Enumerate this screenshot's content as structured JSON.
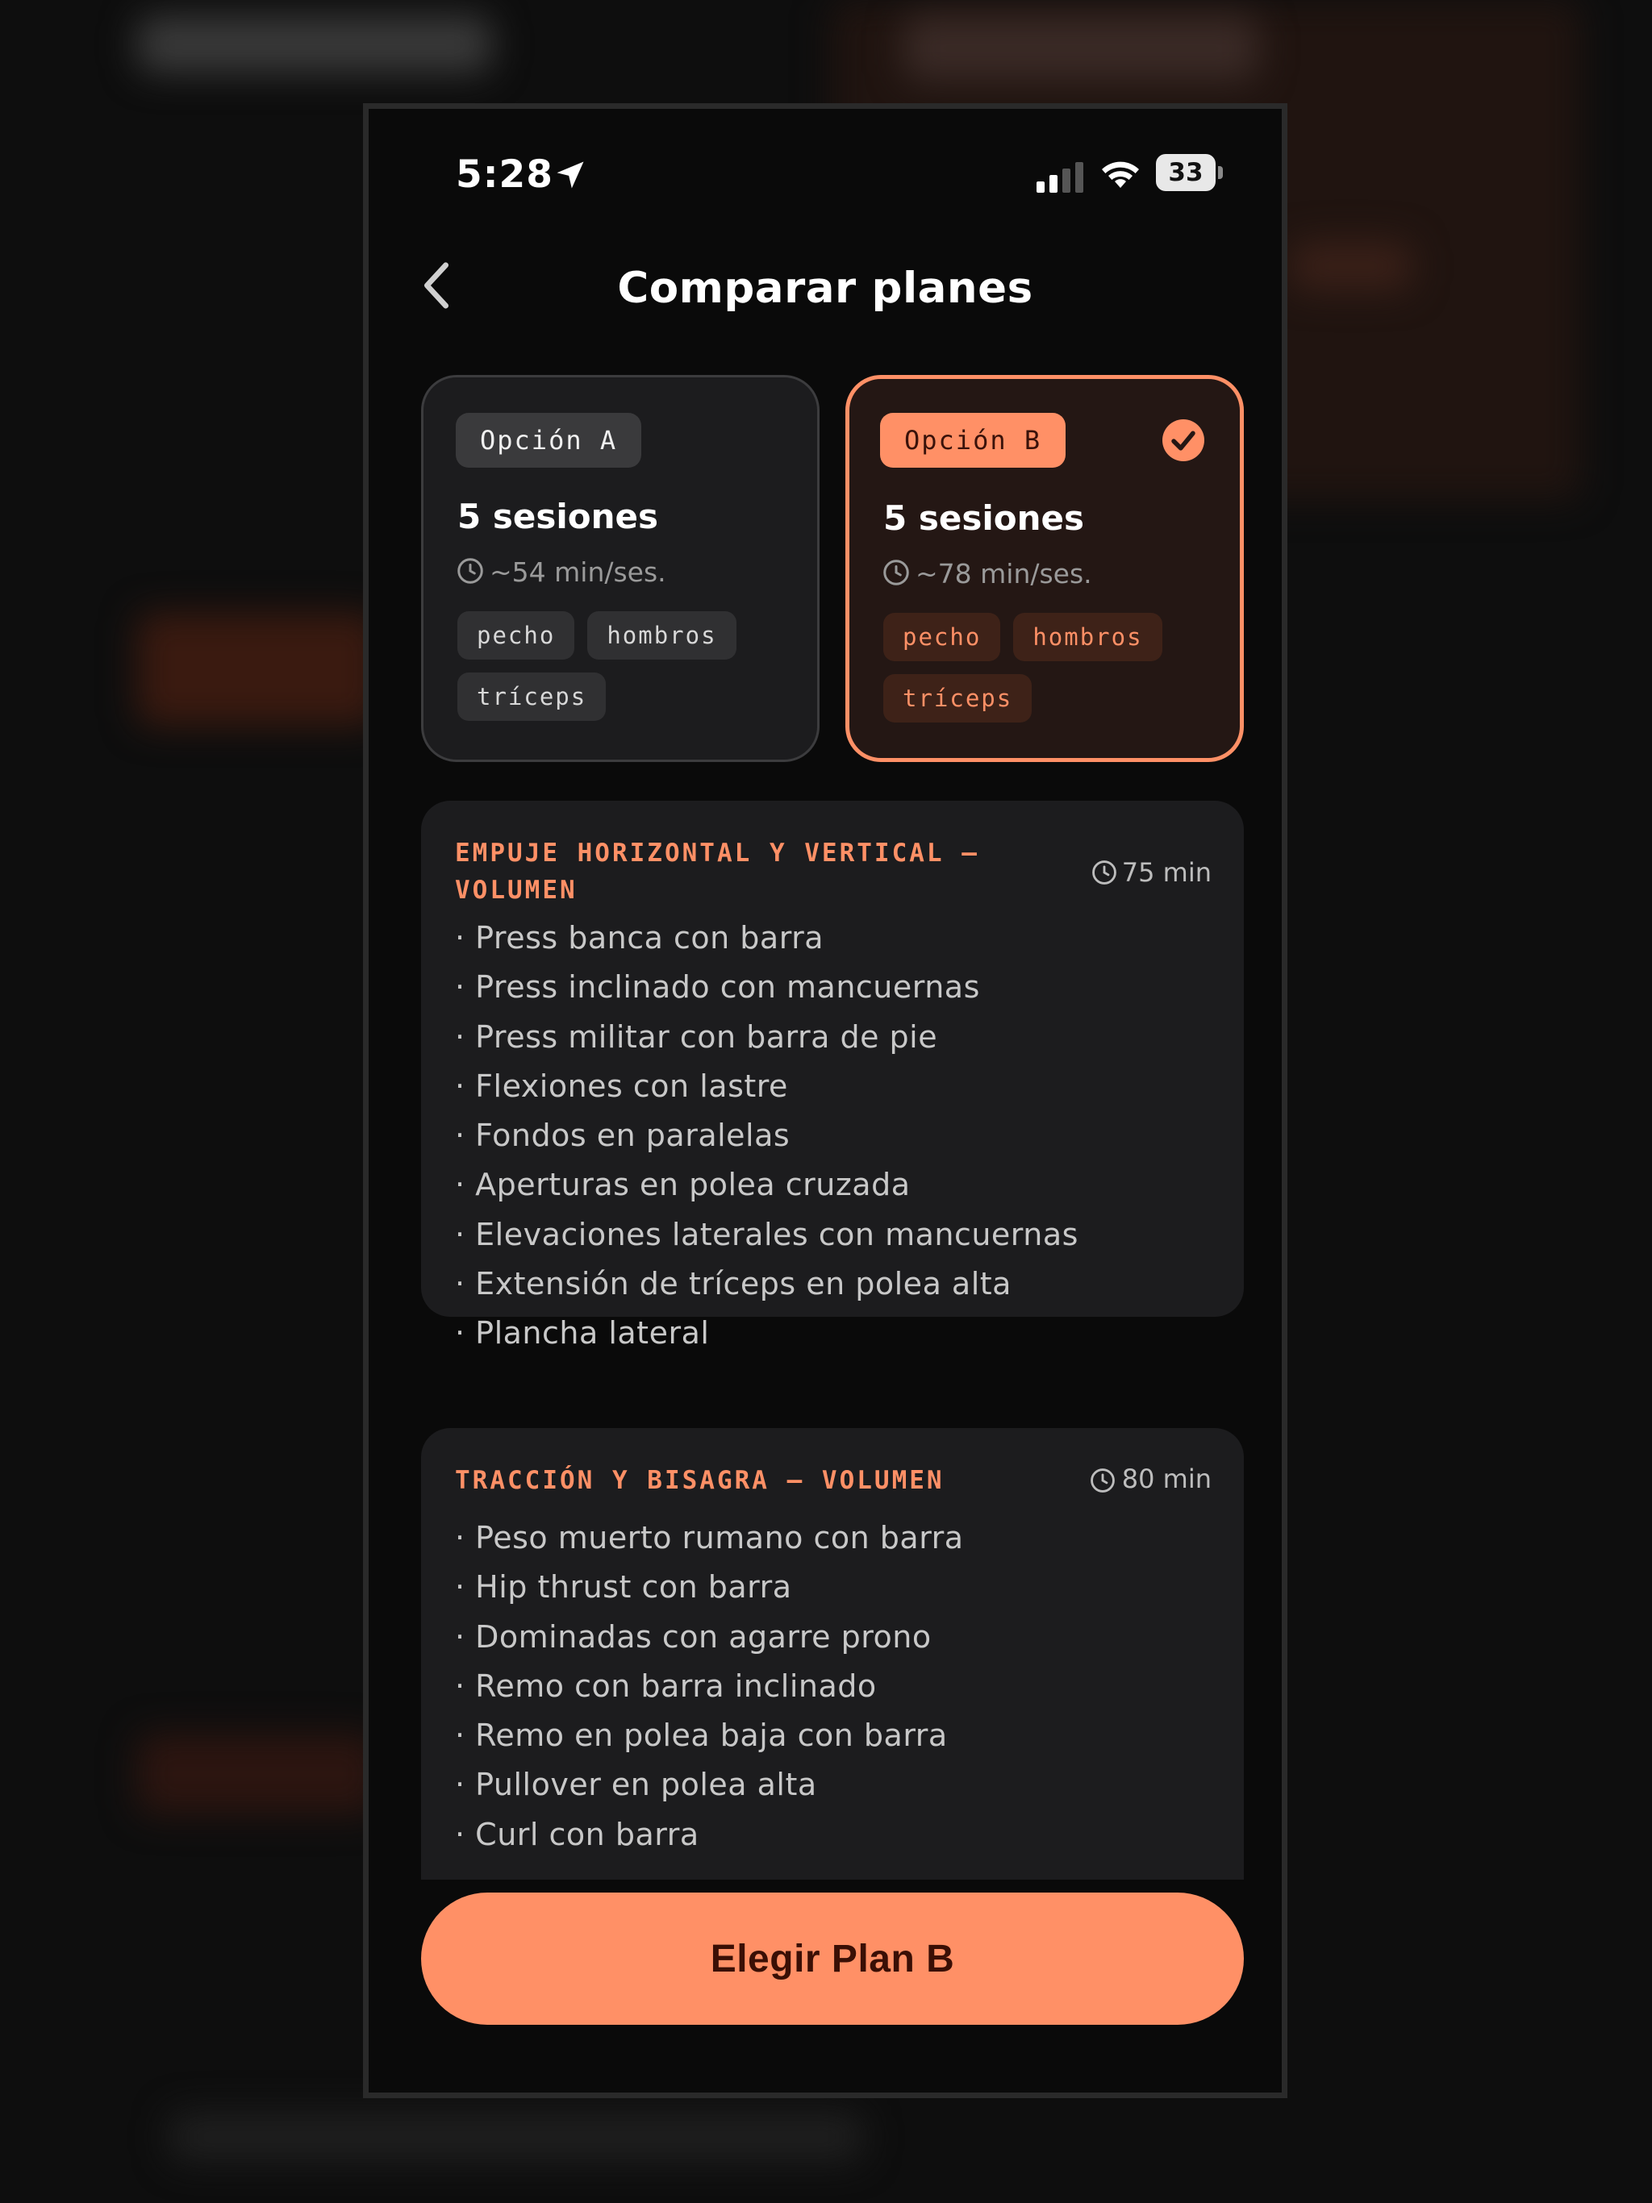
{
  "status_bar": {
    "time": "5:28",
    "battery": "33"
  },
  "header": {
    "title": "Comparar planes"
  },
  "options": [
    {
      "badge": "Opción A",
      "sessions": "5 sesiones",
      "duration": "~54 min/ses.",
      "tags": [
        "pecho",
        "hombros",
        "tríceps"
      ],
      "selected": false
    },
    {
      "badge": "Opción B",
      "sessions": "5 sesiones",
      "duration": "~78 min/ses.",
      "tags": [
        "pecho",
        "hombros",
        "tríceps"
      ],
      "selected": true
    }
  ],
  "sessions": [
    {
      "title_line1": "EMPUJE HORIZONTAL Y VERTICAL —",
      "title_line2": "VOLUMEN",
      "duration": "75 min",
      "exercises": [
        "· Press banca con barra",
        "· Press inclinado con mancuernas",
        "· Press militar con barra de pie",
        "· Flexiones con lastre",
        "· Fondos en paralelas",
        "· Aperturas en polea cruzada",
        "· Elevaciones laterales con mancuernas",
        "· Extensión de tríceps en polea alta",
        "· Plancha lateral"
      ]
    },
    {
      "title_line1": "TRACCIÓN Y BISAGRA — VOLUMEN",
      "duration": "80 min",
      "exercises": [
        "· Peso muerto rumano con barra",
        "· Hip thrust con barra",
        "· Dominadas con agarre prono",
        "· Remo con barra inclinado",
        "· Remo en polea baja con barra",
        "· Pullover en polea alta",
        "· Curl con barra"
      ]
    }
  ],
  "cta": {
    "label": "Elegir Plan B"
  },
  "colors": {
    "accent": "#ff9066",
    "background": "#0a0a0a",
    "card": "#1c1c1e",
    "selected_card": "#241714",
    "cta_text": "#3a0f05"
  }
}
